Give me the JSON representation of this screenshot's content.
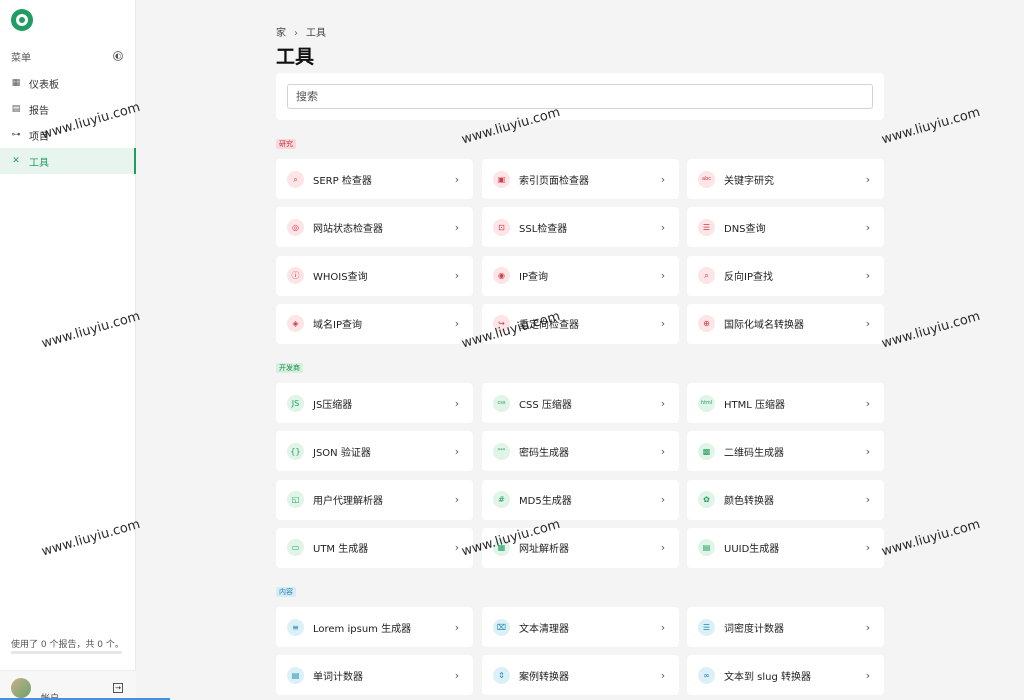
{
  "sidebar": {
    "menu_label": "菜单",
    "items": [
      {
        "label": "仪表板",
        "icon": "grid-icon",
        "glyph": "▦"
      },
      {
        "label": "报告",
        "icon": "report-icon",
        "glyph": "▤"
      },
      {
        "label": "项目",
        "icon": "project-icon",
        "glyph": "⊶"
      },
      {
        "label": "工具",
        "icon": "tools-icon",
        "glyph": "✕",
        "active": true
      }
    ],
    "usage_text": "使用了 0 个报告，共 0 个。",
    "account_label": "帐户"
  },
  "breadcrumb": {
    "home": "家",
    "separator": "›",
    "current": "工具"
  },
  "page_title": "工具",
  "search": {
    "placeholder": "搜索",
    "value": ""
  },
  "sections": [
    {
      "badge": "研究",
      "color": "red",
      "tools": [
        {
          "label": "SERP 检查器",
          "icon": "serp-icon",
          "glyph": "⌕"
        },
        {
          "label": "索引页面检查器",
          "icon": "index-page-icon",
          "glyph": "▣"
        },
        {
          "label": "关键字研究",
          "icon": "keyword-icon",
          "glyph": "abc"
        },
        {
          "label": "网站状态检查器",
          "icon": "website-status-icon",
          "glyph": "◎"
        },
        {
          "label": "SSL检查器",
          "icon": "lock-icon",
          "glyph": "⊡"
        },
        {
          "label": "DNS查询",
          "icon": "dns-icon",
          "glyph": "☰"
        },
        {
          "label": "WHOIS查询",
          "icon": "info-icon",
          "glyph": "ⓘ"
        },
        {
          "label": "IP查询",
          "icon": "ip-icon",
          "glyph": "◉"
        },
        {
          "label": "反向IP查找",
          "icon": "reverse-ip-icon",
          "glyph": "⌕"
        },
        {
          "label": "域名IP查询",
          "icon": "domain-ip-icon",
          "glyph": "◈"
        },
        {
          "label": "重定向检查器",
          "icon": "redirect-icon",
          "glyph": "↪"
        },
        {
          "label": "国际化域名转换器",
          "icon": "globe-icon",
          "glyph": "⊕"
        }
      ]
    },
    {
      "badge": "开发商",
      "color": "green",
      "tools": [
        {
          "label": "JS压缩器",
          "icon": "js-icon",
          "glyph": "JS"
        },
        {
          "label": "CSS 压缩器",
          "icon": "css-icon",
          "glyph": "css"
        },
        {
          "label": "HTML 压缩器",
          "icon": "html-icon",
          "glyph": "html"
        },
        {
          "label": "JSON 验证器",
          "icon": "json-icon",
          "glyph": "{}"
        },
        {
          "label": "密码生成器",
          "icon": "password-icon",
          "glyph": "***"
        },
        {
          "label": "二维码生成器",
          "icon": "qr-code-icon",
          "glyph": "▩"
        },
        {
          "label": "用户代理解析器",
          "icon": "user-agent-icon",
          "glyph": "◱"
        },
        {
          "label": "MD5生成器",
          "icon": "hash-icon",
          "glyph": "#"
        },
        {
          "label": "颜色转换器",
          "icon": "color-icon",
          "glyph": "✿"
        },
        {
          "label": "UTM 生成器",
          "icon": "utm-icon",
          "glyph": "▭"
        },
        {
          "label": "网址解析器",
          "icon": "url-parser-icon",
          "glyph": "▦"
        },
        {
          "label": "UUID生成器",
          "icon": "uuid-icon",
          "glyph": "▤"
        }
      ]
    },
    {
      "badge": "内容",
      "color": "blue",
      "tools": [
        {
          "label": "Lorem ipsum 生成器",
          "icon": "lorem-icon",
          "glyph": "≡"
        },
        {
          "label": "文本清理器",
          "icon": "text-cleaner-icon",
          "glyph": "⌧"
        },
        {
          "label": "词密度计数器",
          "icon": "word-density-icon",
          "glyph": "☰"
        },
        {
          "label": "单词计数器",
          "icon": "word-count-icon",
          "glyph": "▤"
        },
        {
          "label": "案例转换器",
          "icon": "case-icon",
          "glyph": "⇕"
        },
        {
          "label": "文本到 slug 转换器",
          "icon": "slug-icon",
          "glyph": "∞"
        }
      ]
    }
  ],
  "watermark": "www.liuyiu.com"
}
